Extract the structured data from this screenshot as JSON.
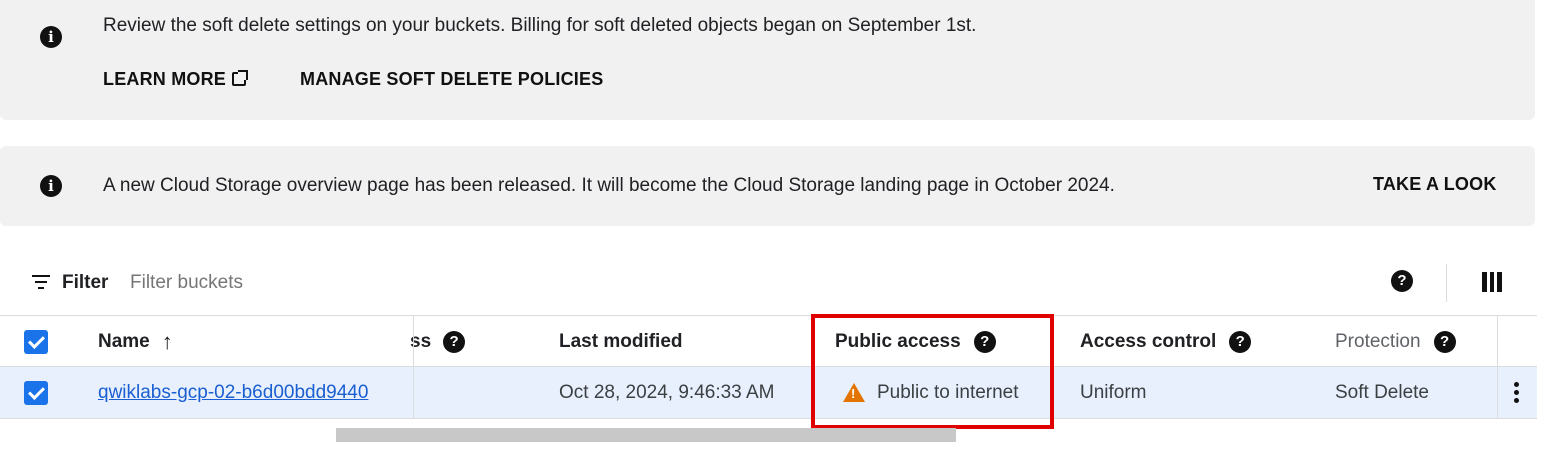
{
  "banners": [
    {
      "text": "Review the soft delete settings on your buckets. Billing for soft deleted objects began on September 1st.",
      "actions": [
        "LEARN MORE",
        "MANAGE SOFT DELETE POLICIES"
      ]
    },
    {
      "text": "A new Cloud Storage overview page has been released. It will become the Cloud Storage landing page in October 2024.",
      "actions": [
        "TAKE A LOOK"
      ]
    }
  ],
  "filter": {
    "label": "Filter",
    "placeholder": "Filter buckets"
  },
  "table": {
    "headers": {
      "name": "Name",
      "partial": "ss",
      "last_modified": "Last modified",
      "public_access": "Public access",
      "access_control": "Access control",
      "protection": "Protection"
    },
    "rows": [
      {
        "name": "qwiklabs-gcp-02-b6d00bdd9440",
        "last_modified": "Oct 28, 2024, 9:46:33 AM",
        "public_access": "Public to internet",
        "access_control": "Uniform",
        "protection": "Soft Delete",
        "selected": true
      }
    ]
  },
  "colors": {
    "accent": "#1a73e8",
    "warning": "#e37400",
    "highlight": "#e00000",
    "banner_bg": "#f1f1f1",
    "selected_row_bg": "#e8f0fe"
  }
}
